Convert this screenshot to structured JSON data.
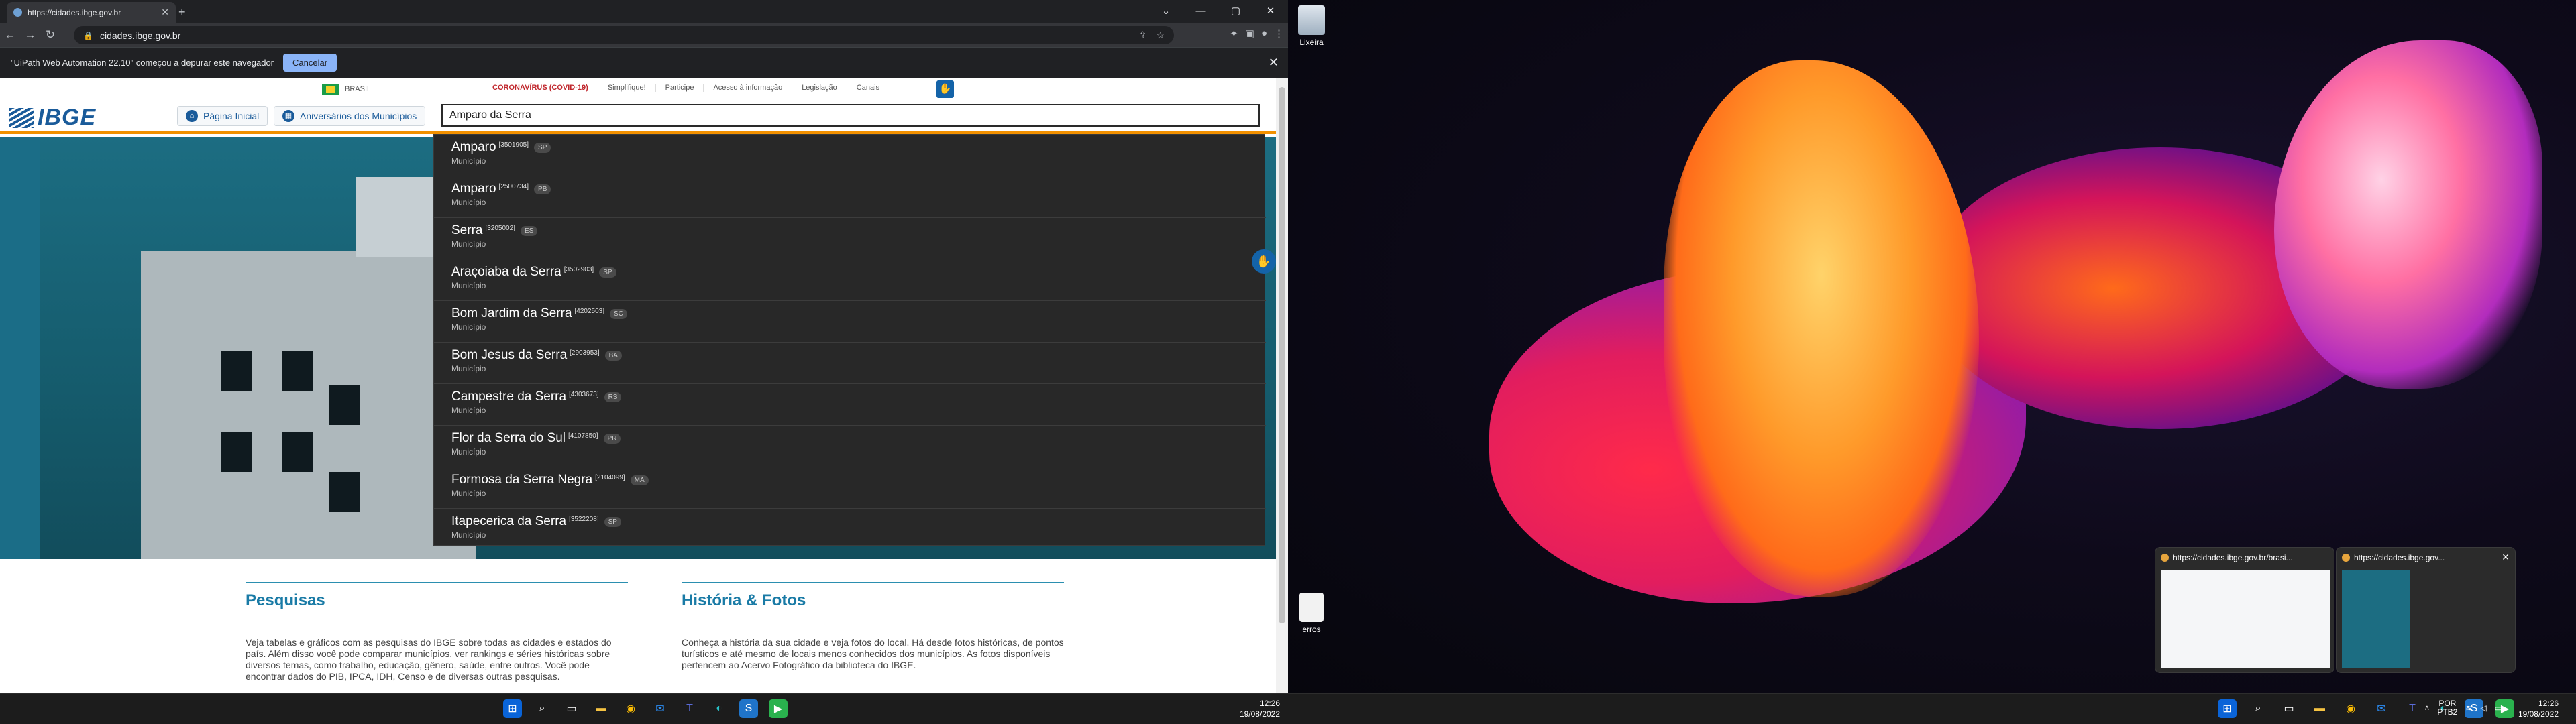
{
  "browser": {
    "tab_title": "https://cidades.ibge.gov.br",
    "address": "cidades.ibge.gov.br",
    "infobar_text": "\"UiPath Web Automation 22.10\" começou a depurar este navegador",
    "infobar_button": "Cancelar"
  },
  "site": {
    "gov": {
      "brasil": "BRASIL",
      "links": [
        "CORONAVÍRUS (COVID-19)",
        "Simplifique!",
        "Participe",
        "Acesso à informação",
        "Legislação",
        "Canais"
      ]
    },
    "logo": "IBGE",
    "buttons": {
      "home": "Página Inicial",
      "anniversaries": "Aniversários dos Municípios"
    },
    "search_value": "Amparo da Serra",
    "results": [
      {
        "name": "Amparo",
        "code": "[3501905]",
        "uf": "SP",
        "type": "Município"
      },
      {
        "name": "Amparo",
        "code": "[2500734]",
        "uf": "PB",
        "type": "Município"
      },
      {
        "name": "Serra",
        "code": "[3205002]",
        "uf": "ES",
        "type": "Município"
      },
      {
        "name": "Araçoiaba da Serra",
        "code": "[3502903]",
        "uf": "SP",
        "type": "Município"
      },
      {
        "name": "Bom Jardim da Serra",
        "code": "[4202503]",
        "uf": "SC",
        "type": "Município"
      },
      {
        "name": "Bom Jesus da Serra",
        "code": "[2903953]",
        "uf": "BA",
        "type": "Município"
      },
      {
        "name": "Campestre da Serra",
        "code": "[4303673]",
        "uf": "RS",
        "type": "Município"
      },
      {
        "name": "Flor da Serra do Sul",
        "code": "[4107850]",
        "uf": "PR",
        "type": "Município"
      },
      {
        "name": "Formosa da Serra Negra",
        "code": "[2104099]",
        "uf": "MA",
        "type": "Município"
      },
      {
        "name": "Itapecerica da Serra",
        "code": "[3522208]",
        "uf": "SP",
        "type": "Município"
      }
    ],
    "sections": [
      {
        "title": "Pesquisas",
        "text": "Veja tabelas e gráficos com as pesquisas do IBGE sobre todas as cidades e estados do país. Além disso você pode comparar municípios, ver rankings e séries históricas sobre diversos temas, como trabalho, educação, gênero, saúde, entre outros. Você pode encontrar dados do PIB, IPCA, IDH, Censo e de diversas outras pesquisas."
      },
      {
        "title": "História & Fotos",
        "text": "Conheça a história da sua cidade e veja fotos do local. Há desde fotos históricas, de pontos turísticos e até mesmo de locais menos conhecidos dos municípios. As fotos disponíveis pertencem ao Acervo Fotográfico da biblioteca do IBGE."
      }
    ]
  },
  "taskbar_left": {
    "time": "12:26",
    "date": "19/08/2022"
  },
  "desktop": {
    "icons": [
      {
        "label": "Lixeira"
      },
      {
        "label": "erros"
      }
    ],
    "previews": [
      {
        "title": "https://cidades.ibge.gov.br/brasi..."
      },
      {
        "title": "https://cidades.ibge.gov..."
      }
    ],
    "tray": {
      "lang1": "POR",
      "lang2": "PTB2",
      "time": "12:26",
      "date": "19/08/2022"
    }
  }
}
